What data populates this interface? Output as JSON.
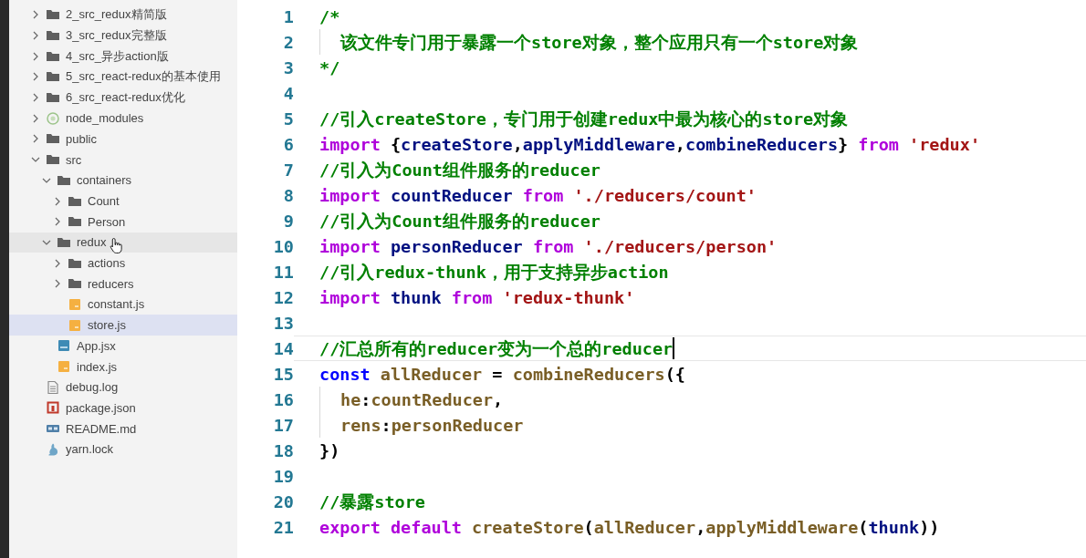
{
  "explorer": {
    "items": [
      {
        "kind": "folder",
        "label": "2_src_redux精简版",
        "expanded": false,
        "selected": false
      },
      {
        "kind": "folder",
        "label": "3_src_redux完整版",
        "expanded": false,
        "selected": false
      },
      {
        "kind": "folder",
        "label": "4_src_异步action版",
        "expanded": false,
        "selected": false
      },
      {
        "kind": "folder",
        "label": "5_src_react-redux的基本使用",
        "expanded": false,
        "selected": false
      },
      {
        "kind": "folder",
        "label": "6_src_react-redux优化",
        "expanded": false,
        "selected": false
      },
      {
        "kind": "node",
        "label": "node_modules",
        "expanded": false,
        "selected": false
      },
      {
        "kind": "folder",
        "label": "public",
        "expanded": false,
        "selected": false
      },
      {
        "kind": "folder",
        "label": "src",
        "expanded": true,
        "selected": false,
        "children": [
          {
            "kind": "folder",
            "label": "containers",
            "expanded": true,
            "selected": false,
            "children": [
              {
                "kind": "folder",
                "label": "Count",
                "expanded": false,
                "selected": false
              },
              {
                "kind": "folder",
                "label": "Person",
                "expanded": false,
                "selected": false
              }
            ]
          },
          {
            "kind": "folder",
            "label": "redux",
            "expanded": true,
            "selected": false,
            "hovered": true,
            "children": [
              {
                "kind": "folder",
                "label": "actions",
                "expanded": false,
                "selected": false
              },
              {
                "kind": "folder",
                "label": "reducers",
                "expanded": false,
                "selected": false
              },
              {
                "kind": "js",
                "label": "constant.js",
                "selected": false
              },
              {
                "kind": "js",
                "label": "store.js",
                "selected": true
              }
            ]
          },
          {
            "kind": "jsx",
            "label": "App.jsx",
            "selected": false
          },
          {
            "kind": "js",
            "label": "index.js",
            "selected": false
          }
        ]
      },
      {
        "kind": "log",
        "label": "debug.log",
        "selected": false
      },
      {
        "kind": "json",
        "label": "package.json",
        "selected": false
      },
      {
        "kind": "md",
        "label": "README.md",
        "selected": false
      },
      {
        "kind": "yarn",
        "label": "yarn.lock",
        "selected": false
      }
    ]
  },
  "editor": {
    "lines": [
      {
        "number": "1",
        "tokens": [
          {
            "kind": "comment",
            "text": "/*"
          }
        ]
      },
      {
        "number": "2",
        "indented": true,
        "tokens": [
          {
            "kind": "comment",
            "text": "该文件专门用于暴露一个store对象，整个应用只有一个store对象"
          }
        ]
      },
      {
        "number": "3",
        "tokens": [
          {
            "kind": "comment",
            "text": "*/"
          }
        ]
      },
      {
        "number": "4"
      },
      {
        "number": "5",
        "tokens": [
          {
            "kind": "comment",
            "text": "//引入createStore，专门用于创建redux中最为核心的store对象"
          }
        ]
      },
      {
        "number": "6",
        "tokens": [
          {
            "kind": "keyword",
            "text": "import"
          },
          {
            "kind": "punct",
            "text": " {"
          },
          {
            "kind": "ident",
            "text": "createStore"
          },
          {
            "kind": "punct",
            "text": ","
          },
          {
            "kind": "ident",
            "text": "applyMiddleware"
          },
          {
            "kind": "punct",
            "text": ","
          },
          {
            "kind": "ident",
            "text": "combineReducers"
          },
          {
            "kind": "punct",
            "text": "}"
          },
          {
            "kind": "keyword",
            "text": " from"
          },
          {
            "kind": "string",
            "text": " 'redux'"
          }
        ]
      },
      {
        "number": "7",
        "tokens": [
          {
            "kind": "comment",
            "text": "//引入为Count组件服务的reducer"
          }
        ]
      },
      {
        "number": "8",
        "tokens": [
          {
            "kind": "keyword",
            "text": "import"
          },
          {
            "kind": "ident",
            "text": " countReducer"
          },
          {
            "kind": "keyword",
            "text": " from"
          },
          {
            "kind": "string",
            "text": " './reducers/count'"
          }
        ]
      },
      {
        "number": "9",
        "tokens": [
          {
            "kind": "comment",
            "text": "//引入为Count组件服务的reducer"
          }
        ]
      },
      {
        "number": "10",
        "tokens": [
          {
            "kind": "keyword",
            "text": "import"
          },
          {
            "kind": "ident",
            "text": " personReducer"
          },
          {
            "kind": "keyword",
            "text": " from"
          },
          {
            "kind": "string",
            "text": " './reducers/person'"
          }
        ]
      },
      {
        "number": "11",
        "tokens": [
          {
            "kind": "comment",
            "text": "//引入redux-thunk，用于支持异步action"
          }
        ]
      },
      {
        "number": "12",
        "tokens": [
          {
            "kind": "keyword",
            "text": "import"
          },
          {
            "kind": "ident",
            "text": " thunk"
          },
          {
            "kind": "keyword",
            "text": " from"
          },
          {
            "kind": "string",
            "text": " 'redux-thunk'"
          }
        ]
      },
      {
        "number": "13"
      },
      {
        "number": "14",
        "current": true,
        "tokens": [
          {
            "kind": "comment",
            "text": "//汇总所有的reducer变为一个总的reducer"
          }
        ]
      },
      {
        "number": "15",
        "tokens": [
          {
            "kind": "storage",
            "text": "const"
          },
          {
            "kind": "func",
            "text": " allReducer"
          },
          {
            "kind": "punct",
            "text": " ="
          },
          {
            "kind": "func",
            "text": " combineReducers"
          },
          {
            "kind": "punct",
            "text": "({"
          }
        ]
      },
      {
        "number": "16",
        "indented": true,
        "tokens": [
          {
            "kind": "func",
            "text": "he"
          },
          {
            "kind": "punct",
            "text": ":"
          },
          {
            "kind": "func",
            "text": "countReducer"
          },
          {
            "kind": "punct",
            "text": ","
          }
        ]
      },
      {
        "number": "17",
        "indented": true,
        "tokens": [
          {
            "kind": "func",
            "text": "rens"
          },
          {
            "kind": "punct",
            "text": ":"
          },
          {
            "kind": "func",
            "text": "personReducer"
          }
        ]
      },
      {
        "number": "18",
        "tokens": [
          {
            "kind": "punct",
            "text": "})"
          }
        ]
      },
      {
        "number": "19"
      },
      {
        "number": "20",
        "tokens": [
          {
            "kind": "comment",
            "text": "//暴露store"
          }
        ]
      },
      {
        "number": "21",
        "tokens": [
          {
            "kind": "keyword",
            "text": "export"
          },
          {
            "kind": "keyword",
            "text": " default"
          },
          {
            "kind": "func",
            "text": " createStore"
          },
          {
            "kind": "punct",
            "text": "("
          },
          {
            "kind": "func",
            "text": "allReducer"
          },
          {
            "kind": "punct",
            "text": ","
          },
          {
            "kind": "func",
            "text": "applyMiddleware"
          },
          {
            "kind": "punct",
            "text": "("
          },
          {
            "kind": "ident",
            "text": "thunk"
          },
          {
            "kind": "punct",
            "text": "))"
          }
        ]
      }
    ]
  }
}
